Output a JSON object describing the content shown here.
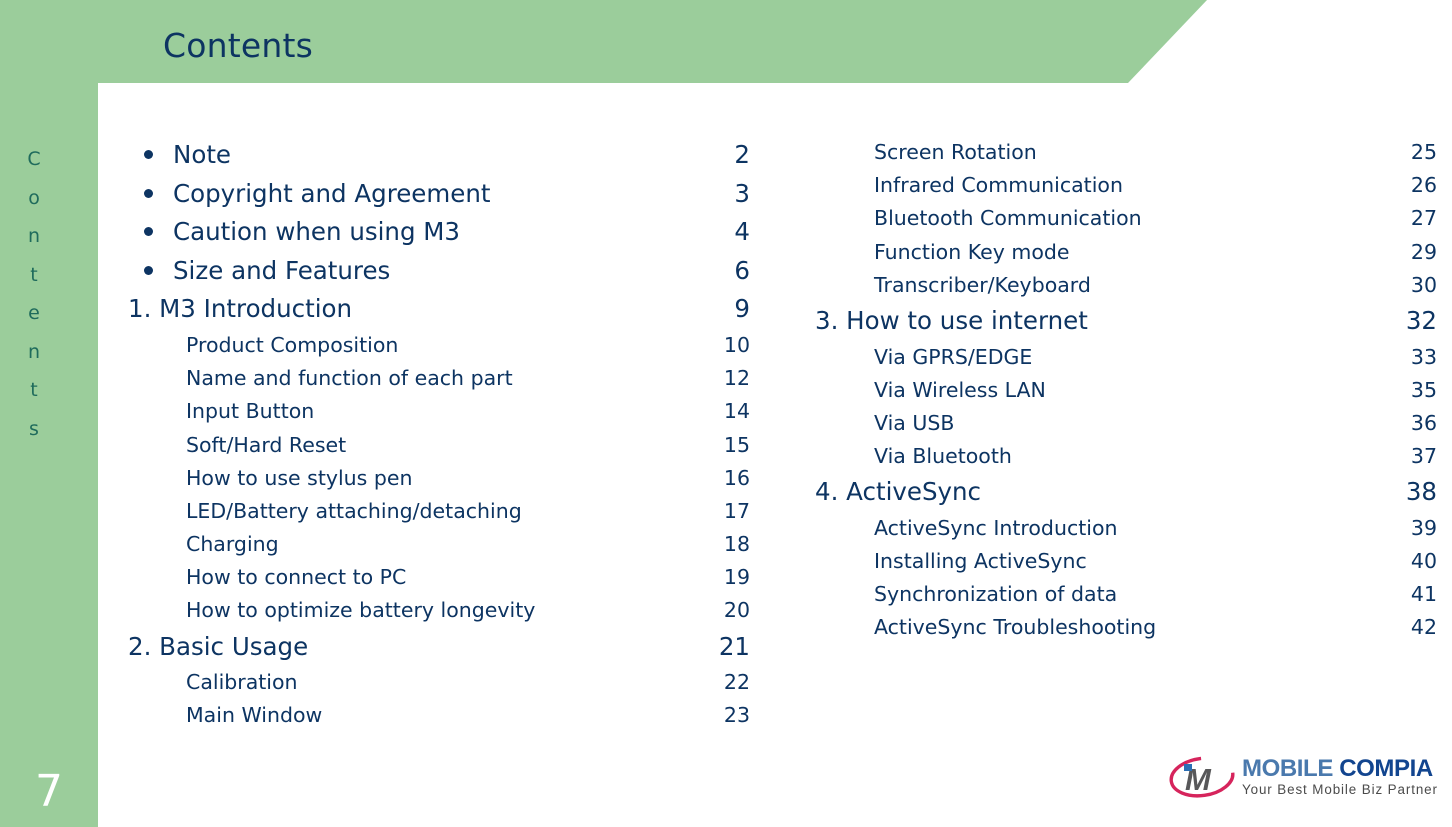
{
  "header": {
    "title": "Contents",
    "band_color": "#9bcd9b",
    "title_color": "#0d3462"
  },
  "sidebar": {
    "vertical_label": "Contents",
    "vertical_label_letters": [
      "C",
      "o",
      "n",
      "t",
      "e",
      "n",
      "t",
      "s"
    ],
    "vertical_label_color": "#1f6b5c",
    "page_number": "7",
    "page_number_color": "#ffffff",
    "background_color": "#9bcd9b"
  },
  "toc": {
    "text_color": "#0d3462",
    "left_column": [
      {
        "level": "bullet",
        "label": "Note",
        "page": "2"
      },
      {
        "level": "bullet",
        "label": "Copyright and Agreement",
        "page": "3"
      },
      {
        "level": "bullet",
        "label": "Caution when using M3",
        "page": "4"
      },
      {
        "level": "bullet",
        "label": "Size and Features",
        "page": "6"
      },
      {
        "level": "section",
        "label": "1. M3 Introduction",
        "page": "9"
      },
      {
        "level": "sub",
        "label": "Product Composition",
        "page": "10"
      },
      {
        "level": "sub",
        "label": "Name and function of each part",
        "page": "12"
      },
      {
        "level": "sub",
        "label": "Input Button",
        "page": "14"
      },
      {
        "level": "sub",
        "label": "Soft/Hard Reset",
        "page": "15"
      },
      {
        "level": "sub",
        "label": "How to use stylus pen",
        "page": "16"
      },
      {
        "level": "sub",
        "label": "LED/Battery attaching/detaching",
        "page": "17"
      },
      {
        "level": "sub",
        "label": "Charging",
        "page": "18"
      },
      {
        "level": "sub",
        "label": "How to connect to PC",
        "page": "19"
      },
      {
        "level": "sub",
        "label": "How to optimize battery longevity",
        "page": "20"
      },
      {
        "level": "section",
        "label": "2. Basic Usage",
        "page": "21"
      },
      {
        "level": "sub",
        "label": "Calibration",
        "page": "22"
      },
      {
        "level": "sub",
        "label": "Main Window",
        "page": "23"
      }
    ],
    "right_column": [
      {
        "level": "sub",
        "label": "Screen Rotation",
        "page": "25"
      },
      {
        "level": "sub",
        "label": "Infrared Communication",
        "page": "26"
      },
      {
        "level": "sub",
        "label": "Bluetooth Communication",
        "page": "27"
      },
      {
        "level": "sub",
        "label": "Function Key mode",
        "page": "29"
      },
      {
        "level": "sub",
        "label": "Transcriber/Keyboard",
        "page": "30"
      },
      {
        "level": "section",
        "label": "3. How to use internet",
        "page": "32"
      },
      {
        "level": "sub",
        "label": "Via GPRS/EDGE",
        "page": "33"
      },
      {
        "level": "sub",
        "label": "Via Wireless LAN",
        "page": "35"
      },
      {
        "level": "sub",
        "label": "Via USB",
        "page": "36"
      },
      {
        "level": "sub",
        "label": "Via Bluetooth",
        "page": "37"
      },
      {
        "level": "section",
        "label": "4. ActiveSync",
        "page": "38"
      },
      {
        "level": "sub",
        "label": "ActiveSync Introduction",
        "page": "39"
      },
      {
        "level": "sub",
        "label": "Installing ActiveSync",
        "page": "40"
      },
      {
        "level": "sub",
        "label": "Synchronization of data",
        "page": "41"
      },
      {
        "level": "sub",
        "label": "ActiveSync Troubleshooting",
        "page": "42"
      }
    ]
  },
  "logo": {
    "mark_letters": "iM",
    "word_1": "MOBILE",
    "word_2": "COMPIA",
    "tagline": "Your Best Mobile Biz Partner",
    "word_1_color": "#4a79ad",
    "word_2_color": "#12458f",
    "tagline_color": "#4b4b4b",
    "ring_color": "#d6245c",
    "mark_color": "#58585a",
    "dot_color": "#2a6fb5"
  }
}
